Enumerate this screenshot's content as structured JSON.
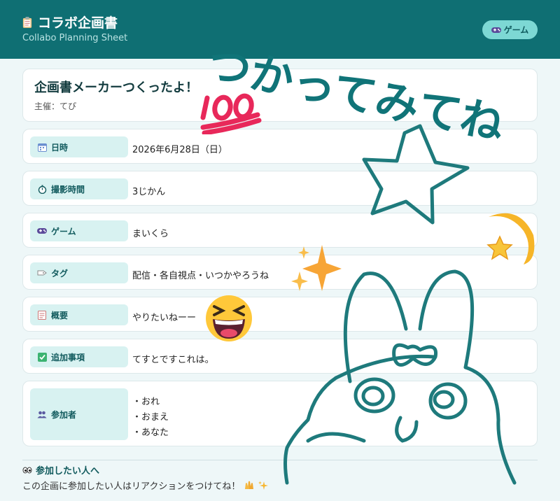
{
  "header": {
    "title": "コラボ企画書",
    "subtitle": "Collabo Planning Sheet",
    "game_chip": "ゲーム"
  },
  "project": {
    "title": "企画書メーカーつくったよ！",
    "host_label": "主催：",
    "host_name": "てぴ"
  },
  "rows": [
    {
      "label": "日時",
      "icon": "calendar-icon",
      "value": "2026年6月28日（日）"
    },
    {
      "label": "撮影時間",
      "icon": "stopwatch-icon",
      "value": "3じかん"
    },
    {
      "label": "ゲーム",
      "icon": "gamepad-icon",
      "value": "まいくら"
    },
    {
      "label": "タグ",
      "icon": "tag-icon",
      "value": "配信・各自視点・いつかやろうね"
    },
    {
      "label": "概要",
      "icon": "memo-icon",
      "value": "やりたいねーー"
    },
    {
      "label": "追加事項",
      "icon": "check-icon",
      "value": "てすとですこれは。"
    },
    {
      "label": "参加者",
      "icon": "people-icon",
      "participants": [
        "・おれ",
        "・おまえ",
        "・あなた"
      ]
    }
  ],
  "footer": {
    "title": "参加したい人へ",
    "text": "この企画に参加したい人はリアクションをつけてね！"
  },
  "doodle": {
    "handwriting": "つかってみてね",
    "stroke_color": "#107478"
  },
  "stickers": [
    "hundred-points-sticker",
    "sparkles-sticker",
    "grinning-squint-sticker",
    "dizzy-star-sticker"
  ]
}
